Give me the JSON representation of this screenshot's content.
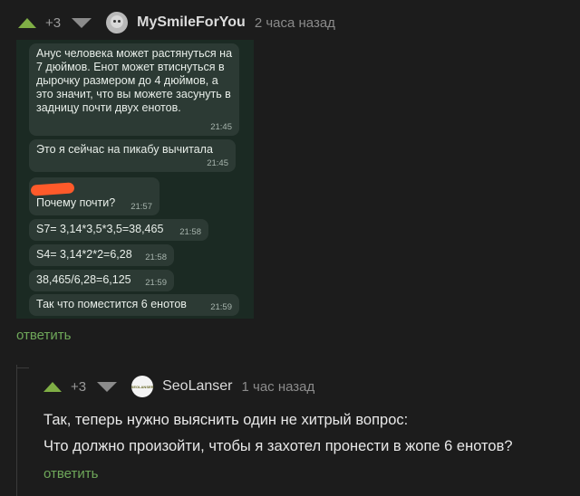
{
  "comment1": {
    "score": "+3",
    "author": "MySmileForYou",
    "time": "2 часа назад",
    "reply": "ответить",
    "messages": [
      {
        "text": "Анус человека может растянуться на 7 дюймов. Енот может втиснуться в дырочку размером до 4 дюймов, а это значит, что вы можете засунуть в задницу почти двух енотов.",
        "time": "21:45"
      },
      {
        "text": "Это я сейчас на пикабу вычитала",
        "time": "21:45"
      },
      {
        "text": "Почему почти?",
        "time": "21:57"
      },
      {
        "text": "S7= 3,14*3,5*3,5=38,465",
        "time": "21:58"
      },
      {
        "text": "S4= 3,14*2*2=6,28",
        "time": "21:58"
      },
      {
        "text": "38,465/6,28=6,125",
        "time": "21:59"
      },
      {
        "text": "Так что поместится 6 енотов",
        "time": "21:59"
      }
    ]
  },
  "comment2": {
    "score": "+3",
    "author": "SeoLanser",
    "avatar_text": "SEOLANSER",
    "time": "1 час назад",
    "lines": [
      "Так, теперь нужно выяснить один не хитрый вопрос:",
      "Что должно произойти, чтобы я захотел пронести в жопе 6 енотов?"
    ],
    "reply": "ответить"
  }
}
